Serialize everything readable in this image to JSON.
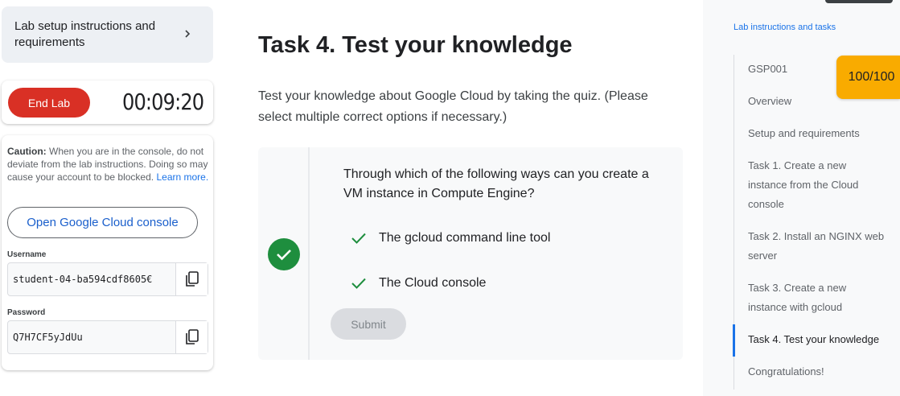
{
  "left": {
    "setup_card": {
      "label": "Lab setup instructions and requirements"
    },
    "end_lab_label": "End Lab",
    "timer": "00:09:20",
    "caution": {
      "prefix": "Caution:",
      "text": " When you are in the console, do not deviate from the lab instructions. Doing so may cause your account to be blocked.",
      "link": "Learn more."
    },
    "open_console_label": "Open Google Cloud console",
    "username_label": "Username",
    "username_value": "student-04-ba594cdf8605€",
    "password_label": "Password",
    "password_value": "Q7H7CF5yJdUu"
  },
  "main": {
    "title": "Task 4. Test your knowledge",
    "description": "Test your knowledge about Google Cloud by taking the quiz. (Please select multiple correct options if necessary.)",
    "quiz": {
      "question": "Through which of the following ways can you create a VM instance in Compute Engine?",
      "options": [
        {
          "label": "The gcloud command line tool",
          "checked": true
        },
        {
          "label": "The Cloud console",
          "checked": true
        }
      ],
      "submit_label": "Submit"
    }
  },
  "sidebar": {
    "heading": "Lab instructions and tasks",
    "score": "100/100",
    "items": [
      {
        "label": "GSP001"
      },
      {
        "label": "Overview"
      },
      {
        "label": "Setup and requirements"
      },
      {
        "label": "Task 1. Create a new instance from the Cloud console"
      },
      {
        "label": "Task 2. Install an NGINX web server"
      },
      {
        "label": "Task 3. Create a new instance with gcloud"
      },
      {
        "label": "Task 4. Test your knowledge",
        "active": true
      },
      {
        "label": "Congratulations!"
      }
    ]
  },
  "colors": {
    "end_lab": "#d93025",
    "success_green": "#1e8e3e",
    "score_badge": "#f9ab00",
    "link_blue": "#1a73e8"
  },
  "icons": {
    "setup_chevron": "chevron-right-icon",
    "copy": "copy-icon",
    "correct": "check-circle-icon",
    "option_check": "check-icon"
  }
}
